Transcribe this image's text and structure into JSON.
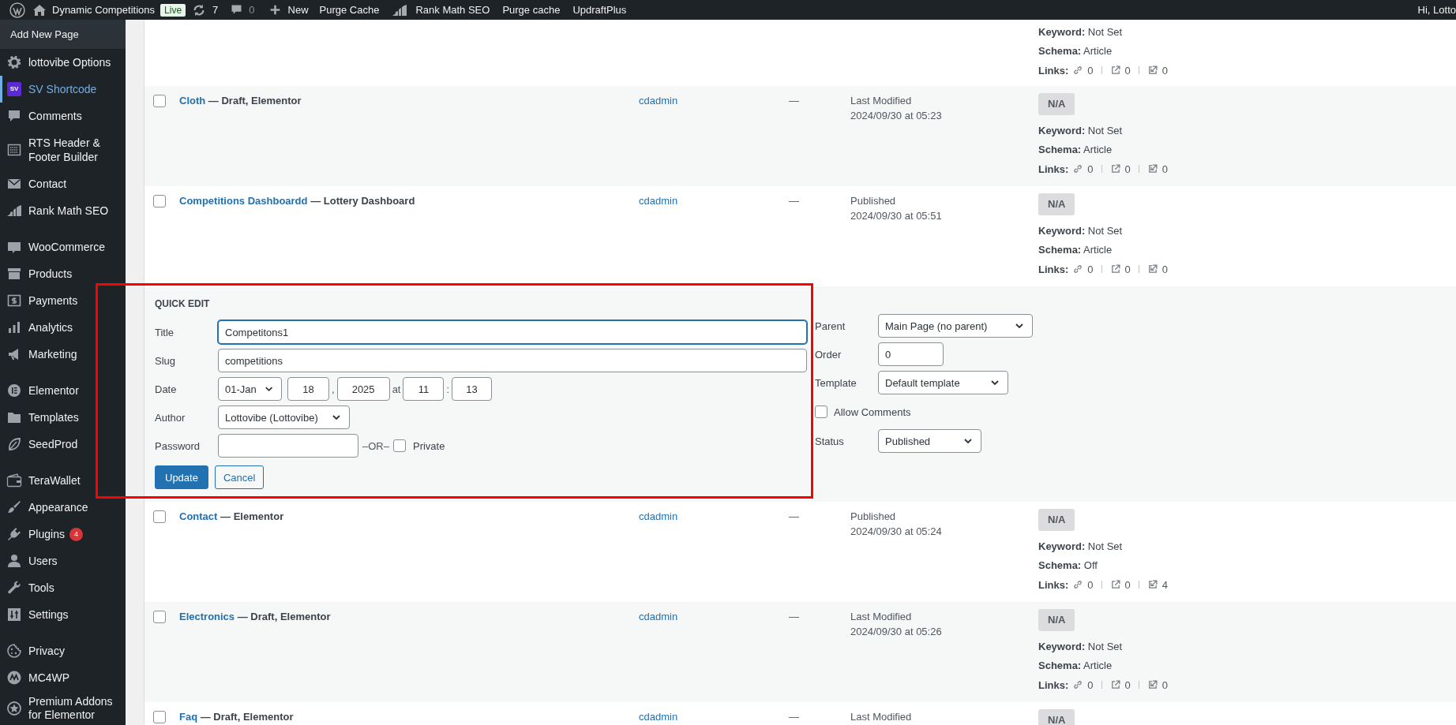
{
  "admin_bar": {
    "site_name": "Dynamic Competitions",
    "environment_badge": "Live",
    "updates_count": "7",
    "comments_count": "0",
    "new_label": "New",
    "items": [
      {
        "kind": "plain",
        "label": "Purge Cache"
      },
      {
        "kind": "rankmath",
        "label": "Rank Math SEO"
      },
      {
        "kind": "plain",
        "label": "Purge cache"
      },
      {
        "kind": "plain",
        "label": "UpdraftPlus"
      }
    ],
    "greeting": "Hi, Lotto"
  },
  "sidebar": {
    "submenu_item": "Add New Page",
    "items": [
      {
        "label": "lottovibe Options",
        "selected": false,
        "separator_before": false
      },
      {
        "label": "SV Shortcode",
        "selected": true,
        "separator_before": false,
        "icon_text": "SV"
      },
      {
        "label": "Comments",
        "selected": false,
        "separator_before": false
      },
      {
        "label": "RTS Header & Footer Builder",
        "selected": false,
        "separator_before": false
      },
      {
        "label": "Contact",
        "selected": false,
        "separator_before": false
      },
      {
        "label": "Rank Math SEO",
        "selected": false,
        "separator_before": false
      },
      {
        "label": "WooCommerce",
        "selected": false,
        "separator_before": true
      },
      {
        "label": "Products",
        "selected": false,
        "separator_before": false
      },
      {
        "label": "Payments",
        "selected": false,
        "separator_before": false
      },
      {
        "label": "Analytics",
        "selected": false,
        "separator_before": false
      },
      {
        "label": "Marketing",
        "selected": false,
        "separator_before": false
      },
      {
        "label": "Elementor",
        "selected": false,
        "separator_before": true
      },
      {
        "label": "Templates",
        "selected": false,
        "separator_before": false
      },
      {
        "label": "SeedProd",
        "selected": false,
        "separator_before": false
      },
      {
        "label": "TeraWallet",
        "selected": false,
        "separator_before": true
      },
      {
        "label": "Appearance",
        "selected": false,
        "separator_before": false
      },
      {
        "label": "Plugins",
        "selected": false,
        "separator_before": false,
        "badge": "4"
      },
      {
        "label": "Users",
        "selected": false,
        "separator_before": false
      },
      {
        "label": "Tools",
        "selected": false,
        "separator_before": false
      },
      {
        "label": "Settings",
        "selected": false,
        "separator_before": false
      },
      {
        "label": "Privacy",
        "selected": false,
        "separator_before": true
      },
      {
        "label": "MC4WP",
        "selected": false,
        "separator_before": false
      },
      {
        "label": "Premium Addons for Elementor",
        "selected": false,
        "separator_before": false
      }
    ]
  },
  "table": {
    "rows": [
      {
        "kind": "post",
        "seo": {
          "keyword_label": "Keyword:",
          "keyword": "Not Set",
          "schema_label": "Schema:",
          "schema": "Article",
          "links_label": "Links:",
          "links": [
            "0",
            "0",
            "0"
          ]
        }
      },
      {
        "kind": "post",
        "checked": false,
        "title": "Cloth",
        "state": "— Draft, Elementor",
        "author": "cdadmin",
        "comments": "—",
        "date_status": "Last Modified",
        "date": "2024/09/30 at 05:23",
        "seo": {
          "score": "N/A",
          "keyword_label": "Keyword:",
          "keyword": "Not Set",
          "schema_label": "Schema:",
          "schema": "Article",
          "links_label": "Links:",
          "links": [
            "0",
            "0",
            "0"
          ]
        }
      },
      {
        "kind": "post",
        "checked": false,
        "title": "Competitions Dashboardd",
        "state": "— Lottery Dashboard",
        "author": "cdadmin",
        "comments": "—",
        "date_status": "Published",
        "date": "2024/09/30 at 05:51",
        "seo": {
          "score": "N/A",
          "keyword_label": "Keyword:",
          "keyword": "Not Set",
          "schema_label": "Schema:",
          "schema": "Article",
          "links_label": "Links:",
          "links": [
            "0",
            "0",
            "0"
          ]
        }
      },
      {
        "kind": "quick_edit",
        "heading": "QUICK EDIT",
        "title": {
          "label": "Title",
          "value": "Competitons1",
          "focused": true
        },
        "slug": {
          "label": "Slug",
          "value": "competitions"
        },
        "date": {
          "label": "Date",
          "month": "01-Jan",
          "day": "18",
          "separator": ",",
          "year": "2025",
          "at": "at",
          "hour": "11",
          "colon": ":",
          "minute": "13"
        },
        "author": {
          "label": "Author",
          "value": "Lottovibe (Lottovibe)"
        },
        "password": {
          "label": "Password",
          "or": "–OR–",
          "private_label": "Private",
          "private_checked": false
        },
        "update_button": "Update",
        "cancel_button": "Cancel",
        "parent": {
          "label": "Parent",
          "value": "Main Page (no parent)"
        },
        "order": {
          "label": "Order",
          "value": "0"
        },
        "template": {
          "label": "Template",
          "value": "Default template"
        },
        "allow_comments": {
          "label": "Allow Comments",
          "checked": false
        },
        "status": {
          "label": "Status",
          "value": "Published"
        }
      },
      {
        "kind": "post",
        "checked": false,
        "title": "Contact",
        "state": "— Elementor",
        "author": "cdadmin",
        "comments": "—",
        "date_status": "Published",
        "date": "2024/09/30 at 05:24",
        "seo": {
          "score": "N/A",
          "keyword_label": "Keyword:",
          "keyword": "Not Set",
          "schema_label": "Schema:",
          "schema": "Off",
          "links_label": "Links:",
          "links": [
            "0",
            "0",
            "4"
          ]
        }
      },
      {
        "kind": "post",
        "checked": false,
        "title": "Electronics",
        "state": "— Draft, Elementor",
        "author": "cdadmin",
        "comments": "—",
        "date_status": "Last Modified",
        "date": "2024/09/30 at 05:26",
        "seo": {
          "score": "N/A",
          "keyword_label": "Keyword:",
          "keyword": "Not Set",
          "schema_label": "Schema:",
          "schema": "Article",
          "links_label": "Links:",
          "links": [
            "0",
            "0",
            "0"
          ]
        }
      },
      {
        "kind": "post",
        "checked": false,
        "title": "Faq",
        "state": "— Draft, Elementor",
        "author": "cdadmin",
        "comments": "—",
        "date_status": "Last Modified",
        "seo": {
          "score": "N/A"
        }
      }
    ]
  }
}
